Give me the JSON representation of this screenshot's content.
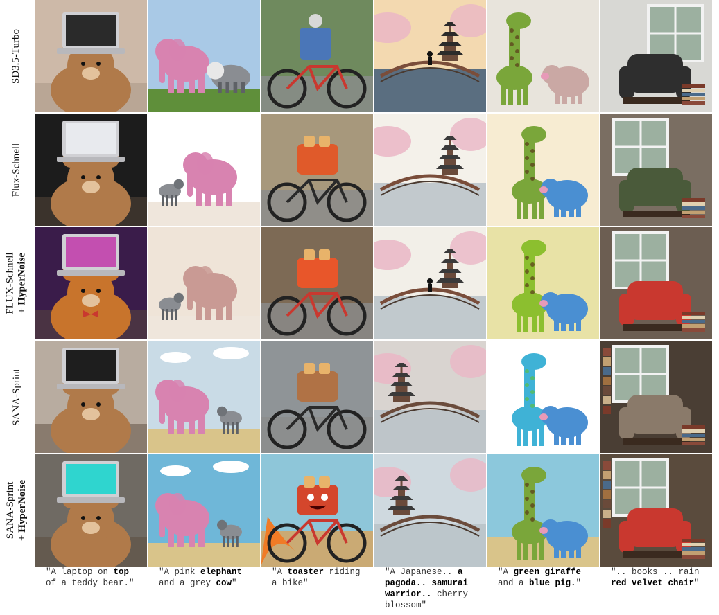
{
  "rows": [
    {
      "label_lines": [
        "SD3.5-Turbo"
      ]
    },
    {
      "label_lines": [
        "Flux-Schnell"
      ]
    },
    {
      "label_lines": [
        "FLUX-Schnell",
        "+ HyperNoise"
      ]
    },
    {
      "label_lines": [
        "SANA-Sprint"
      ]
    },
    {
      "label_lines": [
        "SANA-Sprint",
        "+ HyperNoise"
      ]
    }
  ],
  "captions": [
    [
      {
        "t": "\"A laptop on ",
        "b": false
      },
      {
        "t": "top",
        "b": true
      },
      {
        "t": "\nof a teddy bear.\"",
        "b": false
      }
    ],
    [
      {
        "t": "\"A pink ",
        "b": false
      },
      {
        "t": "elephant",
        "b": true
      },
      {
        "t": "\nand a grey ",
        "b": false
      },
      {
        "t": "cow",
        "b": true
      },
      {
        "t": "\"",
        "b": false
      }
    ],
    [
      {
        "t": "\"A ",
        "b": false
      },
      {
        "t": "toaster",
        "b": true
      },
      {
        "t": " riding\na bike\"",
        "b": false
      }
    ],
    [
      {
        "t": "\"A Japanese.. ",
        "b": false
      },
      {
        "t": "a\npagoda.. samurai\nwarrior..",
        "b": true
      },
      {
        "t": " cherry\nblossom\"",
        "b": false
      }
    ],
    [
      {
        "t": "\"A ",
        "b": false
      },
      {
        "t": "green giraffe",
        "b": true
      },
      {
        "t": "\nand a ",
        "b": false
      },
      {
        "t": "blue pig.",
        "b": true
      },
      {
        "t": "\"",
        "b": false
      }
    ],
    [
      {
        "t": "\".. books .. rain\n",
        "b": false
      },
      {
        "t": "red velvet chair",
        "b": true
      },
      {
        "t": "\"",
        "b": false
      }
    ]
  ],
  "images": [
    [
      "teddy-bear-laptop-image",
      "pink-elephant-cow-image",
      "toaster-bike-image",
      "japanese-pagoda-image",
      "giraffe-pig-image",
      "velvet-chair-books-image"
    ]
  ],
  "palette": {
    "teddy": "#b07a4a",
    "pink": "#d883b0",
    "grey": "#8a8d92",
    "sky": "#a9c9e6",
    "grass": "#d9c48a",
    "red": "#c9382f",
    "green": "#7aa63a",
    "blue": "#4a8fd2",
    "blossom": "#eab6c6"
  }
}
